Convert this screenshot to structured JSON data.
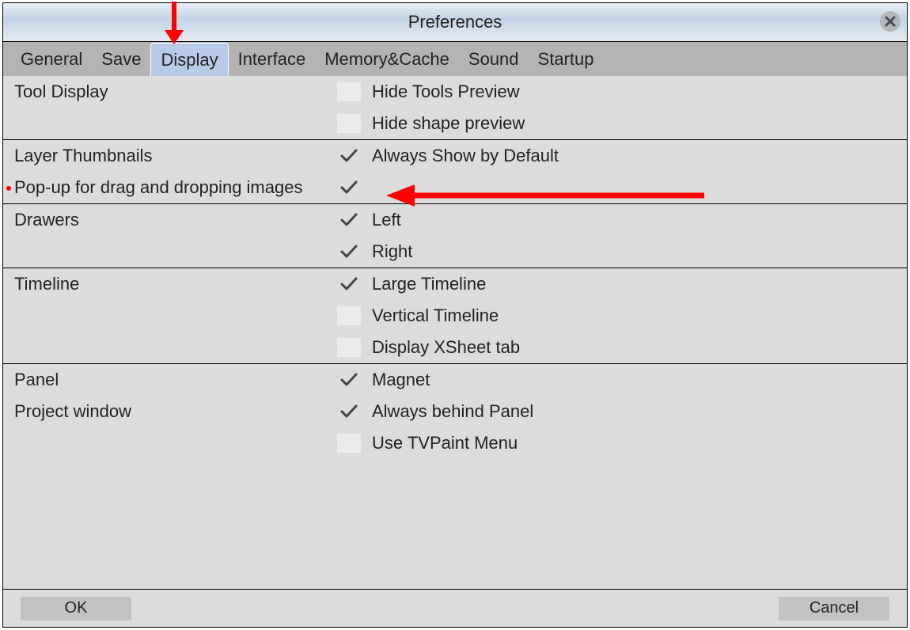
{
  "window": {
    "title": "Preferences"
  },
  "tabs": [
    {
      "label": "General",
      "selected": false
    },
    {
      "label": "Save",
      "selected": false
    },
    {
      "label": "Display",
      "selected": true
    },
    {
      "label": "Interface",
      "selected": false
    },
    {
      "label": "Memory&Cache",
      "selected": false
    },
    {
      "label": "Sound",
      "selected": false
    },
    {
      "label": "Startup",
      "selected": false
    }
  ],
  "sections": [
    {
      "labels": [
        "Tool Display"
      ],
      "options": [
        {
          "checked": false,
          "label": "Hide Tools Preview"
        },
        {
          "checked": false,
          "label": "Hide shape preview"
        }
      ]
    },
    {
      "labels": [
        "Layer Thumbnails",
        "Pop-up for drag and dropping images"
      ],
      "options": [
        {
          "checked": true,
          "label": "Always Show by Default"
        },
        {
          "checked": true,
          "label": ""
        }
      ],
      "highlightLabel": 1
    },
    {
      "labels": [
        "Drawers"
      ],
      "options": [
        {
          "checked": true,
          "label": "Left"
        },
        {
          "checked": true,
          "label": "Right"
        }
      ]
    },
    {
      "labels": [
        "Timeline"
      ],
      "options": [
        {
          "checked": true,
          "label": "Large Timeline"
        },
        {
          "checked": false,
          "label": "Vertical Timeline"
        },
        {
          "checked": false,
          "label": "Display XSheet tab"
        }
      ]
    },
    {
      "labels": [
        "Panel",
        "Project window"
      ],
      "options": [
        {
          "checked": true,
          "label": "Magnet"
        },
        {
          "checked": true,
          "label": "Always behind Panel"
        },
        {
          "checked": false,
          "label": "Use TVPaint Menu"
        }
      ]
    }
  ],
  "footer": {
    "ok": "OK",
    "cancel": "Cancel"
  }
}
